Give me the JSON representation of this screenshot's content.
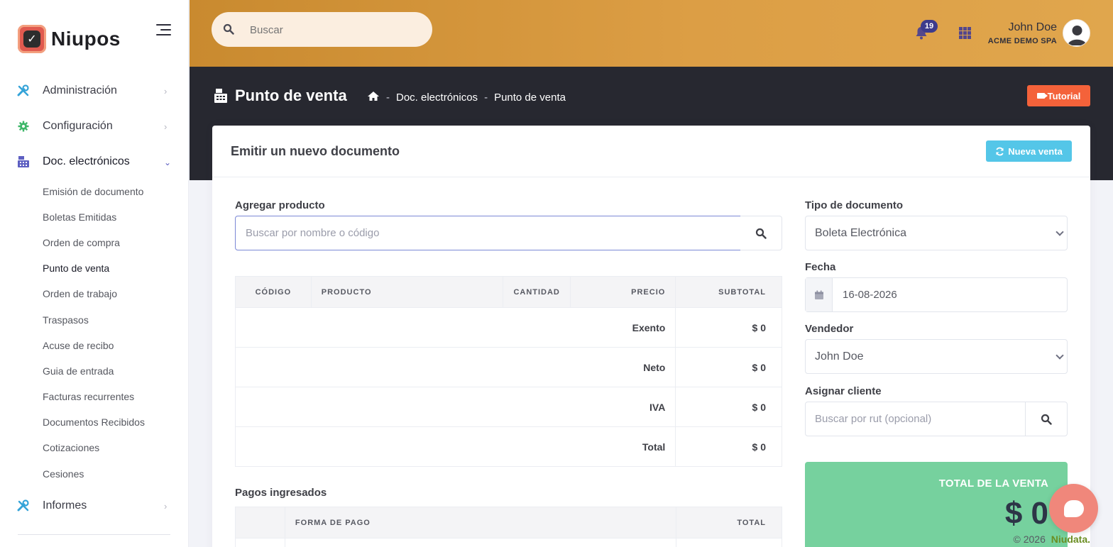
{
  "sidebar": {
    "brand": "Niupos",
    "brand_glyph": "✓",
    "menu": [
      {
        "label": "Administración",
        "icon": "tools-icon"
      },
      {
        "label": "Configuración",
        "icon": "gear-icon"
      },
      {
        "label": "Doc. electrónicos",
        "icon": "cash-register-icon"
      },
      {
        "label": "Informes",
        "icon": "tools-icon"
      }
    ],
    "submenu": [
      "Emisión de documento",
      "Boletas Emitidas",
      "Orden de compra",
      "Punto de venta",
      "Orden de trabajo",
      "Traspasos",
      "Acuse de recibo",
      "Guia de entrada",
      "Facturas recurrentes",
      "Documentos Recibidos",
      "Cotizaciones",
      "Cesiones"
    ]
  },
  "topbar": {
    "search_placeholder": "Buscar",
    "notification_count": "19",
    "user_name": "John Doe",
    "user_company": "ACME DEMO SPA"
  },
  "subheader": {
    "title": "Punto de venta",
    "crumbs": [
      "Doc. electrónicos",
      "Punto de venta"
    ],
    "crumb_sep": "-",
    "tutorial_label": "Tutorial"
  },
  "card": {
    "title": "Emitir un nuevo documento",
    "new_sale_label": "Nueva venta",
    "add_product_label": "Agregar producto",
    "product_placeholder": "Buscar por nombre o código",
    "columns": [
      "CÓDIGO",
      "PRODUCTO",
      "CANTIDAD",
      "PRECIO",
      "SUBTOTAL"
    ],
    "summary": [
      {
        "label": "Exento",
        "value": "$ 0"
      },
      {
        "label": "Neto",
        "value": "$ 0"
      },
      {
        "label": "IVA",
        "value": "$ 0"
      },
      {
        "label": "Total",
        "value": "$ 0"
      }
    ],
    "payments_label": "Pagos ingresados",
    "payment_columns": [
      "FORMA DE PAGO",
      "TOTAL"
    ],
    "doc_type_label": "Tipo de documento",
    "doc_type_value": "Boleta Electrónica",
    "date_label": "Fecha",
    "date_value": "16-08-2026",
    "seller_label": "Vendedor",
    "seller_value": "John Doe",
    "client_label": "Asignar cliente",
    "client_placeholder": "Buscar por rut (opcional)",
    "total_label": "TOTAL DE LA VENTA",
    "total_value": "$ 0"
  },
  "footer": {
    "copyright": "© 2026",
    "brand": "Niudata."
  },
  "colors": {
    "accent": "#dc9e45",
    "dark": "#272830",
    "info": "#54c6e8",
    "success": "#76d19e",
    "danger": "#f4623a"
  }
}
